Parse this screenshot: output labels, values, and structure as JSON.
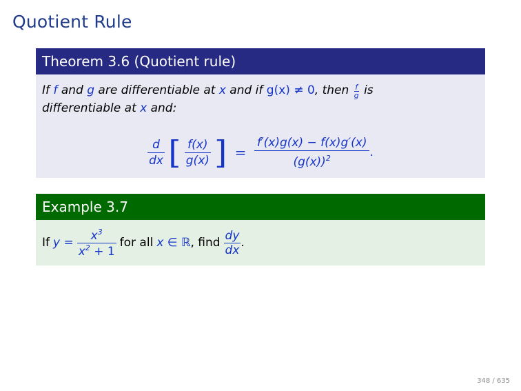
{
  "slide": {
    "title": "Quotient Rule",
    "page_number": "348 / 635"
  },
  "theorem": {
    "heading": "Theorem 3.6 (Quotient rule)",
    "text_if": "If",
    "text_and": "and",
    "text_are_diff": "are differentiable at",
    "text_and_if": "and if",
    "text_then": ", then",
    "text_is": "is",
    "text_diff_at": "differentiable at",
    "text_and_colon": "and:",
    "var_f": "f",
    "var_g": "g",
    "var_x": "x",
    "cond": "g(x) ≠ 0",
    "deriv_d": "d",
    "deriv_dx": "dx",
    "inner_num": "f(x)",
    "inner_den": "g(x)",
    "rhs_num": "f′(x)g(x) − f(x)g′(x)",
    "rhs_den": "(g(x))",
    "rhs_den_exp": "2",
    "period": "."
  },
  "example": {
    "heading": "Example 3.7",
    "text_if": "If",
    "lhs": "y =",
    "num_base": "x",
    "num_exp": "3",
    "den_base": "x",
    "den_exp": "2",
    "den_rest": "+ 1",
    "text_for_all": "for all",
    "domain": "x ∈ ℝ",
    "text_find": ", find",
    "dy": "dy",
    "dx": "dx",
    "period": "."
  }
}
